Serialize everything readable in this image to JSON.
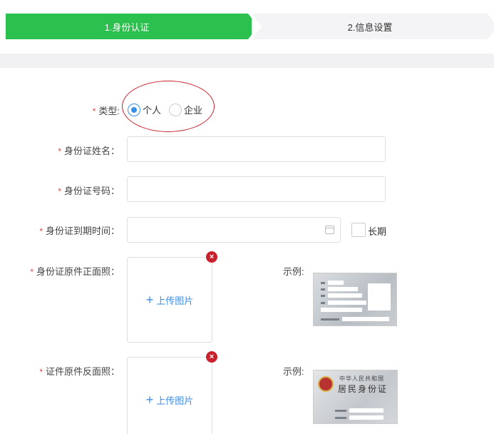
{
  "steps": [
    {
      "label": "1.身份认证",
      "active": true
    },
    {
      "label": "2.信息设置",
      "active": false
    }
  ],
  "form": {
    "type_label": "类型:",
    "type_options": [
      "个人",
      "企业"
    ],
    "type_selected": "个人",
    "id_name_label": "身份证姓名：",
    "id_name_value": "",
    "id_number_label": "身份证号码：",
    "id_number_value": "",
    "id_expiry_label": "身份证到期时间：",
    "id_expiry_value": "",
    "long_term_label": "长期",
    "front_photo_label": "身份证原件正面照：",
    "back_photo_label": "证件原件反面照：",
    "upload_label": "上传图片",
    "upload_plus": "+",
    "remove_glyph": "×",
    "example_label": "示例:",
    "required_mark": "*"
  },
  "card_back": {
    "line1": "中华人民共和国",
    "line2": "居民身份证"
  },
  "colors": {
    "active_step": "#2cc04e",
    "accent": "#3a8ee6",
    "required": "#e0434a",
    "annotation": "#c8212d"
  },
  "icons": [
    "calendar-icon",
    "plus-icon",
    "close-icon",
    "emblem-icon"
  ]
}
